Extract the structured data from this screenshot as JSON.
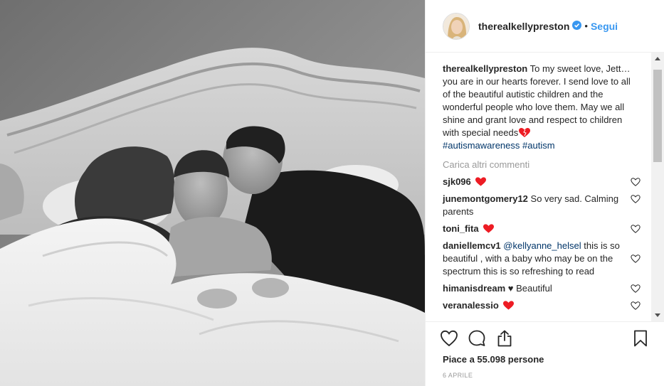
{
  "post": {
    "username": "therealkellypreston",
    "follow_label": "Segui",
    "separator": "•",
    "caption": "To my sweet love, Jett… you are in our hearts forever. I send love to all of the beautiful autistic children and the wonderful people who love them. May we all shine and grant love and respect to children with special needs",
    "hashtags": [
      "#autismawareness",
      "#autism"
    ],
    "load_more": "Carica altri commenti",
    "likes": "Piace a 55.098 persone",
    "date": "6 APRILE"
  },
  "comments": [
    {
      "user": "sjk096",
      "text": "",
      "heart_emoji": true
    },
    {
      "user": "junemontgomery12",
      "text": "So very sad. Calming parents"
    },
    {
      "user": "toni_fita",
      "text": "",
      "heart_emoji": true
    },
    {
      "user": "daniellemcv1",
      "mention": "@kellyanne_helsel",
      "text": "this is so beautiful , with a baby who may be on the spectrum this is so refreshing to read"
    },
    {
      "user": "himanisdream",
      "text": "♥ Beautiful"
    },
    {
      "user": "veranalessio",
      "text": "",
      "heart_emoji": true
    }
  ],
  "colors": {
    "link": "#3897f0",
    "hashtag": "#003569",
    "muted": "#999999",
    "text": "#262626",
    "heart_red": "#ed1c24",
    "verified_blue": "#3897f0"
  },
  "icons": [
    "heart-icon",
    "comment-icon",
    "share-icon",
    "bookmark-icon",
    "verified-badge-icon",
    "small-heart-icon"
  ]
}
